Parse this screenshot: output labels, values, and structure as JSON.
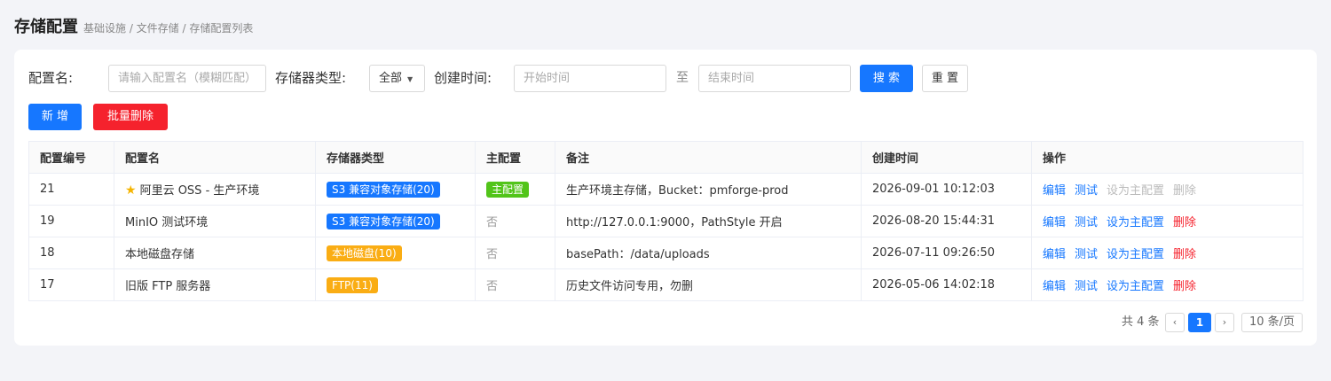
{
  "header": {
    "title": "存储配置",
    "breadcrumb": "基础设施 / 文件存储 / 存储配置列表"
  },
  "filters": {
    "name_label": "配置名:",
    "name_placeholder": "请输入配置名（模糊匹配）",
    "type_label": "存储器类型:",
    "type_value": "全部",
    "time_label": "创建时间:",
    "start_placeholder": "开始时间",
    "to": "至",
    "end_placeholder": "结束时间",
    "search_label": "搜 索",
    "reset_label": "重 置"
  },
  "actions": {
    "add_label": "新 增",
    "batch_delete_label": "批量删除"
  },
  "table": {
    "headers": [
      "配置编号",
      "配置名",
      "存储器类型",
      "主配置",
      "备注",
      "创建时间",
      "操作"
    ],
    "rows": [
      {
        "id": "21",
        "name": "阿里云 OSS - 生产环境",
        "starred": true,
        "type": "S3 兼容对象存储(20)",
        "type_color": "#1677ff",
        "master": "主配置",
        "master_is_tag": true,
        "remark": "生产环境主存储，Bucket：pmforge-prod",
        "created": "2026-09-01 10:12:03",
        "ops": {
          "edit": "编辑",
          "test": "测试",
          "set_master": "设为主配置",
          "delete": "删除",
          "disabled": true
        }
      },
      {
        "id": "19",
        "name": "MinIO 测试环境",
        "starred": false,
        "type": "S3 兼容对象存储(20)",
        "type_color": "#1677ff",
        "master": "否",
        "master_is_tag": false,
        "remark": "http://127.0.0.1:9000，PathStyle 开启",
        "created": "2026-08-20 15:44:31",
        "ops": {
          "edit": "编辑",
          "test": "测试",
          "set_master": "设为主配置",
          "delete": "删除",
          "disabled": false
        }
      },
      {
        "id": "18",
        "name": "本地磁盘存储",
        "starred": false,
        "type": "本地磁盘(10)",
        "type_color": "#faad14",
        "master": "否",
        "master_is_tag": false,
        "remark": "basePath：/data/uploads",
        "created": "2026-07-11 09:26:50",
        "ops": {
          "edit": "编辑",
          "test": "测试",
          "set_master": "设为主配置",
          "delete": "删除",
          "disabled": false
        }
      },
      {
        "id": "17",
        "name": "旧版 FTP 服务器",
        "starred": false,
        "type": "FTP(11)",
        "type_color": "#faad14",
        "master": "否",
        "master_is_tag": false,
        "remark": "历史文件访问专用，勿删",
        "created": "2026-05-06 14:02:18",
        "ops": {
          "edit": "编辑",
          "test": "测试",
          "set_master": "设为主配置",
          "delete": "删除",
          "disabled": false
        }
      }
    ]
  },
  "pagination": {
    "total": "共 4 条",
    "prev": "‹",
    "current": "1",
    "next": "›",
    "page_size": "10 条/页"
  },
  "colors": {
    "primary": "#1677ff",
    "danger": "#f5222d",
    "success": "#52c41a",
    "warning": "#faad14",
    "page_bg": "#f3f4f8"
  },
  "icons": {
    "star": "star-icon",
    "caret": "caret-down-icon"
  }
}
